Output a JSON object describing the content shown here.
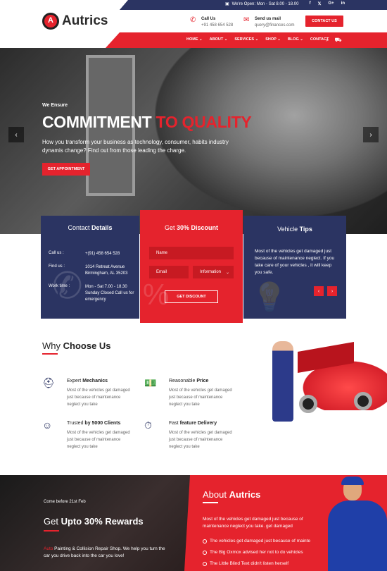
{
  "topbar": {
    "hours": "We're Open: Mon - Sat 8.00 - 18.00",
    "social": [
      "f",
      "𝕏",
      "G+",
      "in"
    ]
  },
  "header": {
    "logo_text": "Autrics",
    "call": {
      "title": "Call Us",
      "value": "+91 458 654 528"
    },
    "mail": {
      "title": "Send us mail",
      "value": "query@finances.com"
    },
    "contact_button": "CONTACT US"
  },
  "nav": {
    "items": [
      "HOME ⌄",
      "ABOUT ⌄",
      "SERVICES ⌄",
      "SHOP ⌄",
      "BLOG ⌄",
      "CONTACT"
    ]
  },
  "hero": {
    "subtitle": "We Ensure",
    "title_white": "COMMITMENT ",
    "title_red": "TO QUALITY",
    "description": "How you transform your business as technology, consumer, habits industry dynamis change? Find out from those leading the charge.",
    "button": "GET APPOINTMENT"
  },
  "contact_box": {
    "title_light": "Contact ",
    "title_bold": "Details",
    "rows": [
      {
        "label": "Call us :",
        "value": "+(91) 458 654 528"
      },
      {
        "label": "Find us :",
        "value": "1014 Retreat Avenue Birmingham, AL 35203"
      },
      {
        "label": "Work time :",
        "value": "Mon - Sat 7.00 - 18.30 Sunday Closed Call us for emergency"
      }
    ]
  },
  "discount_box": {
    "title_light": "Get ",
    "title_bold": "30% Discount",
    "name_placeholder": "Name",
    "email_placeholder": "Email",
    "select_value": "Information",
    "button": "GET DISCOUNT"
  },
  "tips_box": {
    "title_light": "Vehicle ",
    "title_bold": "Tips",
    "text": "Most of the vehicles get damaged just because of maintenance neglect. If you take care of your vehicles , it will keep you safe."
  },
  "why": {
    "title_light": "Why ",
    "title_bold": "Choose Us",
    "features": [
      {
        "light": "Expert ",
        "bold": "Mechanics",
        "desc": "Most of the vehicles get damaged just because of maintenance neglect you take"
      },
      {
        "light": "Reasonable ",
        "bold": "Price",
        "desc": "Most of the vehicles get damaged just because of maintenance neglect you take"
      },
      {
        "light": "Trusted ",
        "bold": "by 5000 Clients",
        "desc": "Most of the vehicles get damaged just because of maintenance neglect you take"
      },
      {
        "light": "Fast ",
        "bold": "feature Delivery",
        "desc": "Most of the vehicles get damaged just because of maintenance neglect you take"
      }
    ]
  },
  "rewards": {
    "small": "Come before 21st Feb",
    "title_light": "Get ",
    "title_bold": "Upto 30% Rewards",
    "desc_red": "Auto",
    "desc": " Painting & Collision Repair Shop. We help you turn the car you drive back into the car you love!"
  },
  "about": {
    "title_light": "About ",
    "title_bold": "Autrics",
    "desc": "Most of the vehicles get damaged just because of maintenance neglect you take. get damaged",
    "items": [
      "The vehicles get damaged just because of mainte",
      "The Big Oxmox advised her not to do vehicles",
      "The Little Blind Text didn't listen herself"
    ]
  }
}
